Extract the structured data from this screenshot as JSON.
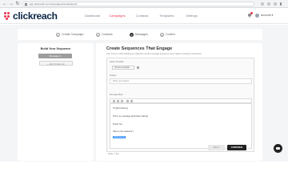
{
  "browser": {
    "url": "app.clickreach.com/campaigns/create/step/3"
  },
  "header": {
    "brand_name": "clickreach",
    "nav": [
      {
        "label": "Dashboard"
      },
      {
        "label": "Campaigns",
        "active": true
      },
      {
        "label": "Contacts"
      },
      {
        "label": "Templates"
      },
      {
        "label": "Settings"
      }
    ],
    "user_name": "Account ▾"
  },
  "stepper": {
    "steps": [
      {
        "num": "1",
        "label": "Create Campaign"
      },
      {
        "num": "2",
        "label": "Contacts"
      },
      {
        "num": "3",
        "label": "Messages",
        "active": true
      },
      {
        "num": "4",
        "label": "Confirm"
      }
    ]
  },
  "left_panel": {
    "title": "Build Your Sequence",
    "primary_button": "Message 1",
    "secondary_button": "+ Add Follow Up"
  },
  "right_panel": {
    "title": "Create Sequences That Engage",
    "subtitle": "Use tools to start building an effective email message sequence that makes a lasting impression.",
    "editor": {
      "select_label": "Select Template",
      "select_value": "Choose template",
      "subject_label": "Subject",
      "subject_placeholder": "Write your subject...",
      "body_label": "Message Body",
      "body_lines": [
        "Hi {{First Name}},",
        "This is my message {{Company Name}}",
        "Thank You",
        "Have a nice weekend :)",
        "{{Signature}}"
      ]
    },
    "footer_text": "Delay: 1 day",
    "back_button": "BACK",
    "continue_button": "CONTINUE"
  },
  "colors": {
    "brand": "#e8344e",
    "primary_dark": "#222222",
    "selection": "#3390ff"
  }
}
